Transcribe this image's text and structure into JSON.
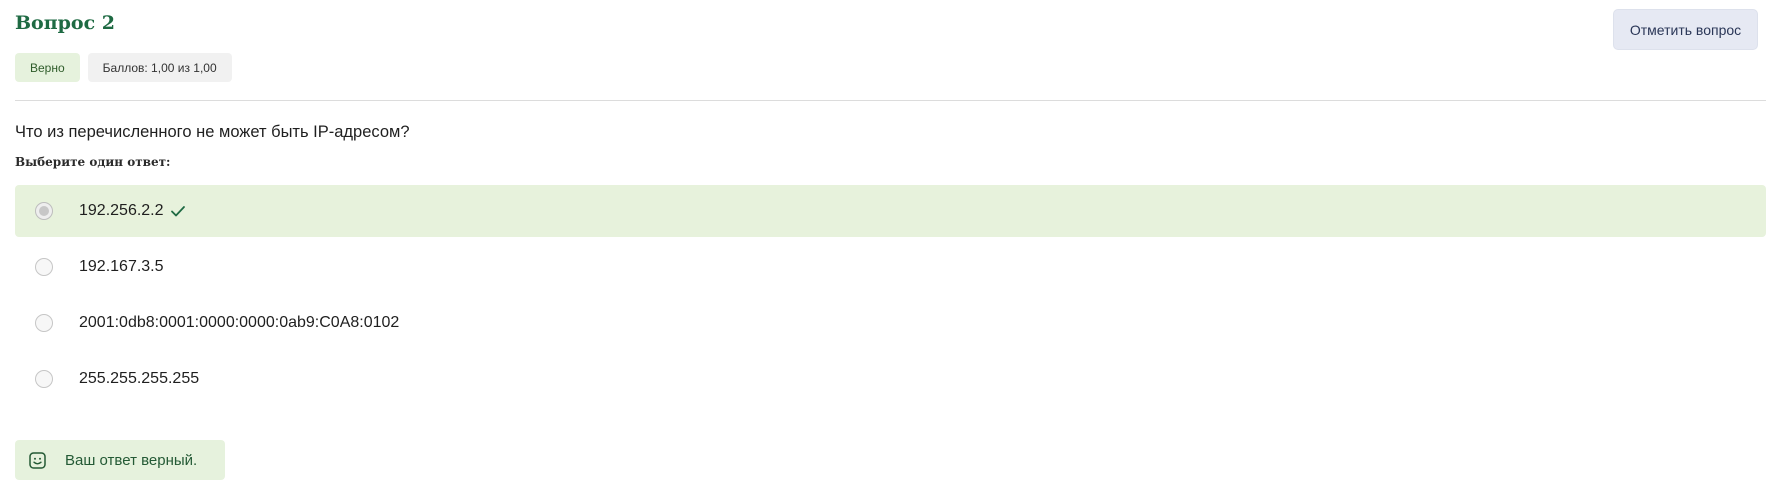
{
  "question": {
    "title": "Вопрос 2",
    "flag_button_label": "Отметить вопрос",
    "state_badge": "Верно",
    "grade_badge": "Баллов: 1,00 из 1,00",
    "text": "Что из перечисленного не может быть IP-адресом?",
    "prompt": "Выберите один ответ:"
  },
  "answers": [
    {
      "label": "192.256.2.2",
      "selected": true,
      "correct": true
    },
    {
      "label": "192.167.3.5",
      "selected": false,
      "correct": false
    },
    {
      "label": "2001:0db8:0001:0000:0000:0ab9:C0A8:0102",
      "selected": false,
      "correct": false
    },
    {
      "label": "255.255.255.255",
      "selected": false,
      "correct": false
    }
  ],
  "feedback": {
    "text": "Ваш ответ верный.",
    "icon": "smile-icon"
  },
  "colors": {
    "title": "#1e6a43",
    "correct_bg": "#e7f2dc",
    "check": "#1e6a43",
    "flag_bg": "#e6e9f3"
  }
}
